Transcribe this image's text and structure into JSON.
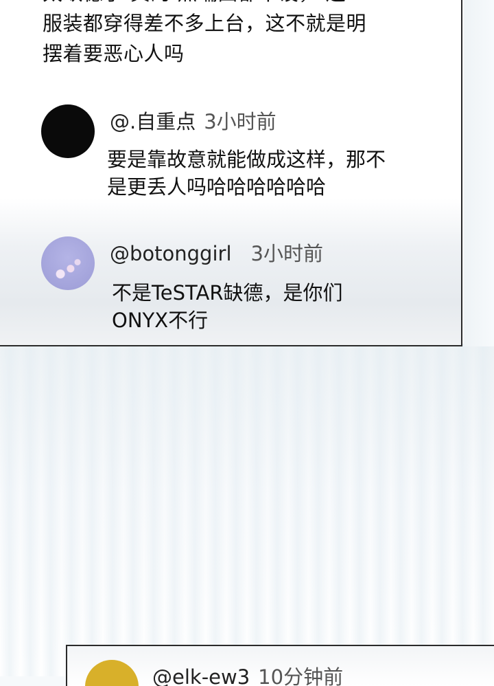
{
  "top_comment": {
    "line1": "太缺德了  真的  点瑞曲都不设，  连",
    "line2": "服装都穿得差不多上台，这不就是明",
    "line3": "摆着要恶心人吗"
  },
  "comments": [
    {
      "username": "@.自重点",
      "time": "3小时前",
      "text_line1": "要是靠故意就能做成这样，那不",
      "text_line2": "是更丢人吗哈哈哈哈哈哈",
      "avatar_color": "#0a0a0a"
    },
    {
      "username": "@botonggirl",
      "time": "3小时前",
      "text_line1": "不是TeSTAR缺德，是你们",
      "text_line2": "ONYX不行",
      "avatar_color": "#a8a8de"
    }
  ],
  "next_comment": {
    "username": "@elk-ew3",
    "time": "10分钟前",
    "avatar_color": "#d8b02a"
  }
}
